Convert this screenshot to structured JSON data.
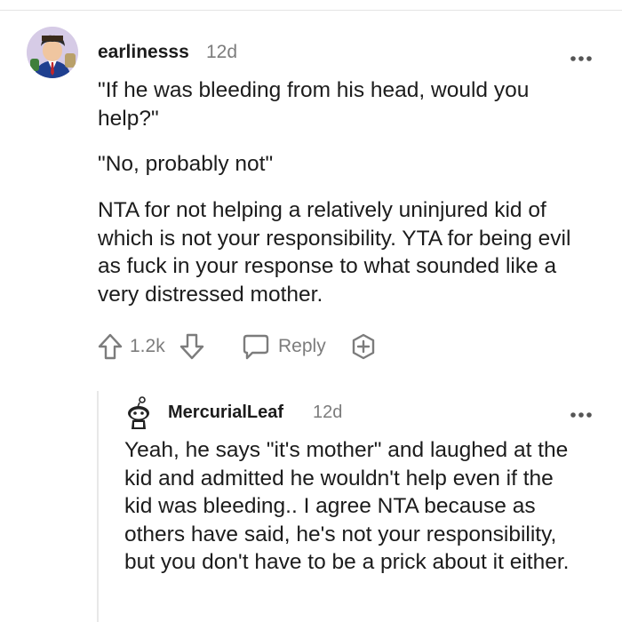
{
  "comments": [
    {
      "username": "earlinesss",
      "timestamp": "12d",
      "paragraphs": [
        "\"If he was bleeding from his head, would you help?\"",
        "\"No, probably not\"",
        "NTA for not helping a relatively uninjured kid of which is not your responsibility. YTA for being evil as fuck in your response to what sounded like a very distressed mother."
      ],
      "votes": "1.2k",
      "reply_label": "Reply",
      "icons": {
        "upvote": "upvote-arrow-icon",
        "downvote": "downvote-arrow-icon",
        "reply": "speech-bubble-icon",
        "award": "award-plus-icon",
        "more": "more-dots-icon"
      }
    },
    {
      "username": "MercurialLeaf",
      "timestamp": "12d",
      "paragraphs": [
        "Yeah, he says \"it's mother\" and laughed at the kid and admitted he wouldn't help even if the kid was bleeding.. I agree NTA because as others have said, he's not your responsibility, but you don't have to be a prick about it either."
      ]
    }
  ],
  "colors": {
    "text": "#1c1c1c",
    "meta": "#7c7c7c",
    "icon": "#7c7c7c",
    "divider": "#e4e4e4"
  }
}
